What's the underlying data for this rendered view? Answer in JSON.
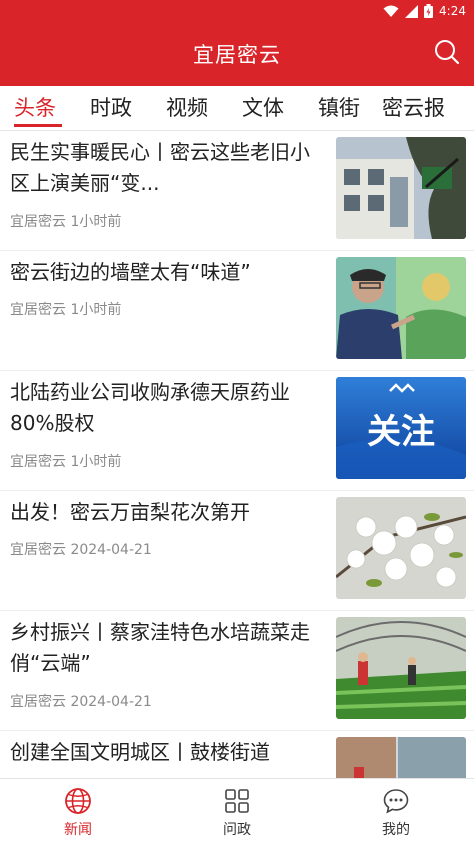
{
  "status_bar": {
    "time": "4:24"
  },
  "header": {
    "title": "宜居密云"
  },
  "tabs": [
    "头条",
    "时政",
    "视频",
    "文体",
    "镇街",
    "密云报"
  ],
  "active_tab": "头条",
  "feed": [
    {
      "headline": "民生实事暖民心丨密云这些老旧小区上演美丽“变...",
      "source": "宜居密云",
      "time": "1小时前",
      "image": "old-residential-building-photo"
    },
    {
      "headline": "密云街边的墙壁太有“味道”",
      "source": "宜居密云",
      "time": "1小时前",
      "image": "man-painting-mural-photo"
    },
    {
      "headline": "北陆药业公司收购承德天原药业80%股权",
      "source": "宜居密云",
      "time": "1小时前",
      "image": "guanzhu-banner-image",
      "image_text": "关注"
    },
    {
      "headline": "出发！密云万亩梨花次第开",
      "source": "宜居密云",
      "time": "2024-04-21",
      "image": "pear-blossom-photo"
    },
    {
      "headline": "乡村振兴丨蔡家洼特色水培蔬菜走俏“云端”",
      "source": "宜居密云",
      "time": "2024-04-21",
      "image": "greenhouse-vegetables-photo"
    },
    {
      "headline": "创建全国文明城区丨鼓楼街道",
      "source": "",
      "time": "",
      "image": "street-scene-photo"
    }
  ],
  "bottom_nav": [
    {
      "label": "新闻",
      "icon": "globe-icon",
      "active": true
    },
    {
      "label": "问政",
      "icon": "grid-icon",
      "active": false
    },
    {
      "label": "我的",
      "icon": "chat-bubble-icon",
      "active": false
    }
  ],
  "colors": {
    "brand_red": "#d9252a",
    "meta_gray": "#8a8a8a",
    "text": "#222222"
  }
}
